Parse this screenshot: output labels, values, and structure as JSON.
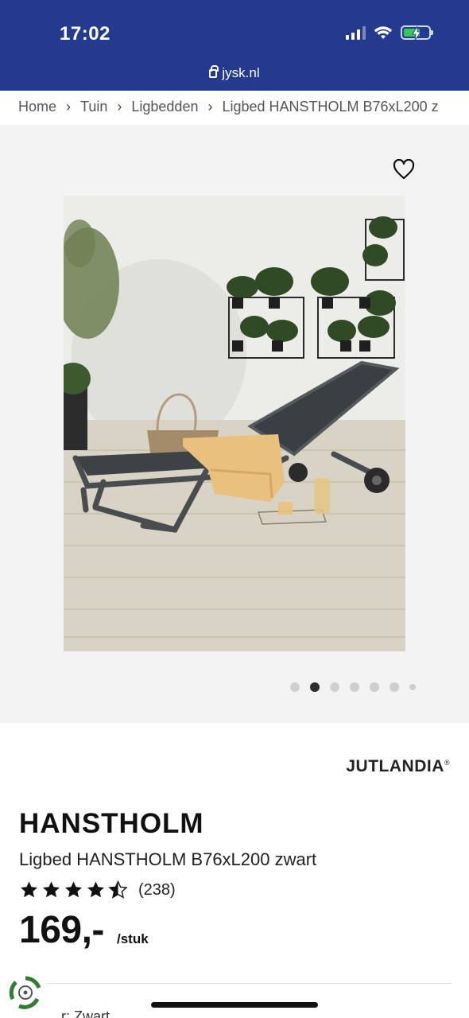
{
  "status_bar": {
    "time": "17:02"
  },
  "browser": {
    "url": "jysk.nl"
  },
  "breadcrumb": {
    "items": [
      "Home",
      "Tuin",
      "Ligbedden",
      "Ligbed HANSTHOLM B76xL200 z"
    ],
    "separator": "›"
  },
  "gallery": {
    "image_count": 7,
    "active_index": 1
  },
  "product": {
    "brand": "JUTLANDIA",
    "brand_mark": "®",
    "name": "HANSTHOLM",
    "subtitle": "Ligbed HANSTHOLM B76xL200 zwart",
    "rating": 4.5,
    "rating_max": 5,
    "review_count": "(238)",
    "price": "169,-",
    "unit": "/stuk",
    "variant_label_peek": "...r: Zwart"
  },
  "colors": {
    "brand_blue": "#233a8f",
    "gallery_bg": "#f3f3f3",
    "eco_green": "#2e7d32"
  }
}
